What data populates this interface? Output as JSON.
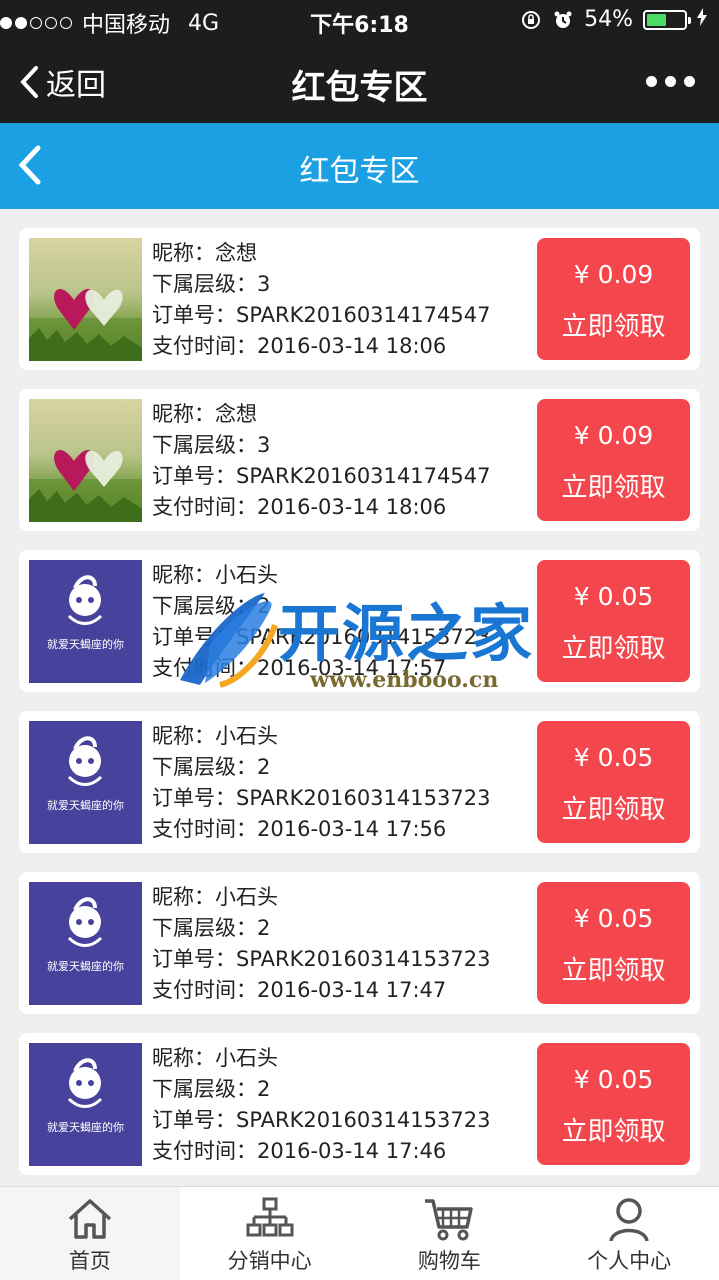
{
  "status_bar": {
    "carrier": "中国移动",
    "network": "4G",
    "time": "下午6:18",
    "battery": "54%",
    "battery_level": 0.54
  },
  "nav": {
    "back_label": "返回",
    "title": "红包专区"
  },
  "page": {
    "title": "红包专区"
  },
  "labels": {
    "nickname": "昵称：",
    "level": "下属层级：",
    "order": "订单号：",
    "paytime": "支付时间："
  },
  "items": [
    {
      "nickname": "念想",
      "level": "3",
      "order": "SPARK20160314174547",
      "paytime": "2016-03-14 18:06",
      "amount": "¥ 0.09",
      "button": "立即领取",
      "avatar": "hearts-photo"
    },
    {
      "nickname": "念想",
      "level": "3",
      "order": "SPARK20160314174547",
      "paytime": "2016-03-14 18:06",
      "amount": "¥ 0.09",
      "button": "立即领取",
      "avatar": "hearts-photo"
    },
    {
      "nickname": "小石头",
      "level": "2",
      "order": "SPARK20160314153723",
      "paytime": "2016-03-14 17:57",
      "amount": "¥ 0.05",
      "button": "立即领取",
      "avatar": "scorpio-logo"
    },
    {
      "nickname": "小石头",
      "level": "2",
      "order": "SPARK20160314153723",
      "paytime": "2016-03-14 17:56",
      "amount": "¥ 0.05",
      "button": "立即领取",
      "avatar": "scorpio-logo"
    },
    {
      "nickname": "小石头",
      "level": "2",
      "order": "SPARK20160314153723",
      "paytime": "2016-03-14 17:47",
      "amount": "¥ 0.05",
      "button": "立即领取",
      "avatar": "scorpio-logo"
    },
    {
      "nickname": "小石头",
      "level": "2",
      "order": "SPARK20160314153723",
      "paytime": "2016-03-14 17:46",
      "amount": "¥ 0.05",
      "button": "立即领取",
      "avatar": "scorpio-logo"
    }
  ],
  "avatar_text": {
    "scorpio": "就爱天蝎座的你"
  },
  "watermark": {
    "name": "开源之家",
    "url": "www.enbooo.cn"
  },
  "tabbar": [
    {
      "label": "首页",
      "icon": "home-icon",
      "active": true
    },
    {
      "label": "分销中心",
      "icon": "network-icon",
      "active": false
    },
    {
      "label": "购物车",
      "icon": "cart-icon",
      "active": false
    },
    {
      "label": "个人中心",
      "icon": "person-icon",
      "active": false
    }
  ],
  "colors": {
    "header_blue": "#1aa0e3",
    "red_button": "#f3474d",
    "dark_bar": "#1d1d1f"
  }
}
